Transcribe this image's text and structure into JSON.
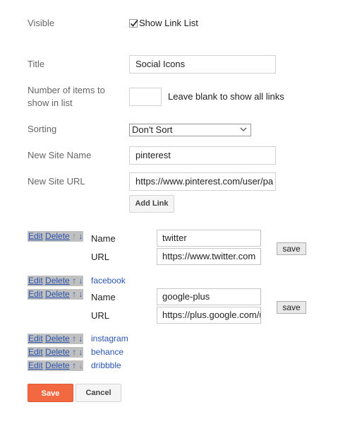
{
  "visible": {
    "label": "Visible",
    "checkbox_label": "Show Link List",
    "checked": true
  },
  "title": {
    "label": "Title",
    "value": "Social Icons"
  },
  "num_items": {
    "label_line1": "Number of items to",
    "label_line2": "show in list",
    "value": "",
    "hint": "Leave blank to show all links"
  },
  "sorting": {
    "label": "Sorting",
    "value": "Don't Sort"
  },
  "new_site_name": {
    "label": "New Site Name",
    "value": "pinterest"
  },
  "new_site_url": {
    "label": "New Site URL",
    "value": "https://www.pinterest.com/user/pa"
  },
  "add_link_label": "Add Link",
  "controls": {
    "edit": "Edit",
    "delete": "Delete",
    "up": "↑",
    "down": "↓"
  },
  "links": [
    {
      "name": "twitter",
      "url": "https://www.twitter.com",
      "editing": true,
      "name_label": "Name",
      "url_label": "URL",
      "save_label": "save"
    },
    {
      "name": "facebook",
      "editing": false
    },
    {
      "name": "google-plus",
      "url": "https://plus.google.com/u",
      "editing": true,
      "name_label": "Name",
      "url_label": "URL",
      "save_label": "save"
    },
    {
      "name": "instagram",
      "editing": false
    },
    {
      "name": "behance",
      "editing": false
    },
    {
      "name": "dribbble",
      "editing": false
    }
  ],
  "footer": {
    "save_label": "Save",
    "cancel_label": "Cancel"
  },
  "colors": {
    "save_button": "#f26941",
    "link": "#2a55b0",
    "control_bg": "#c0c0c0"
  }
}
